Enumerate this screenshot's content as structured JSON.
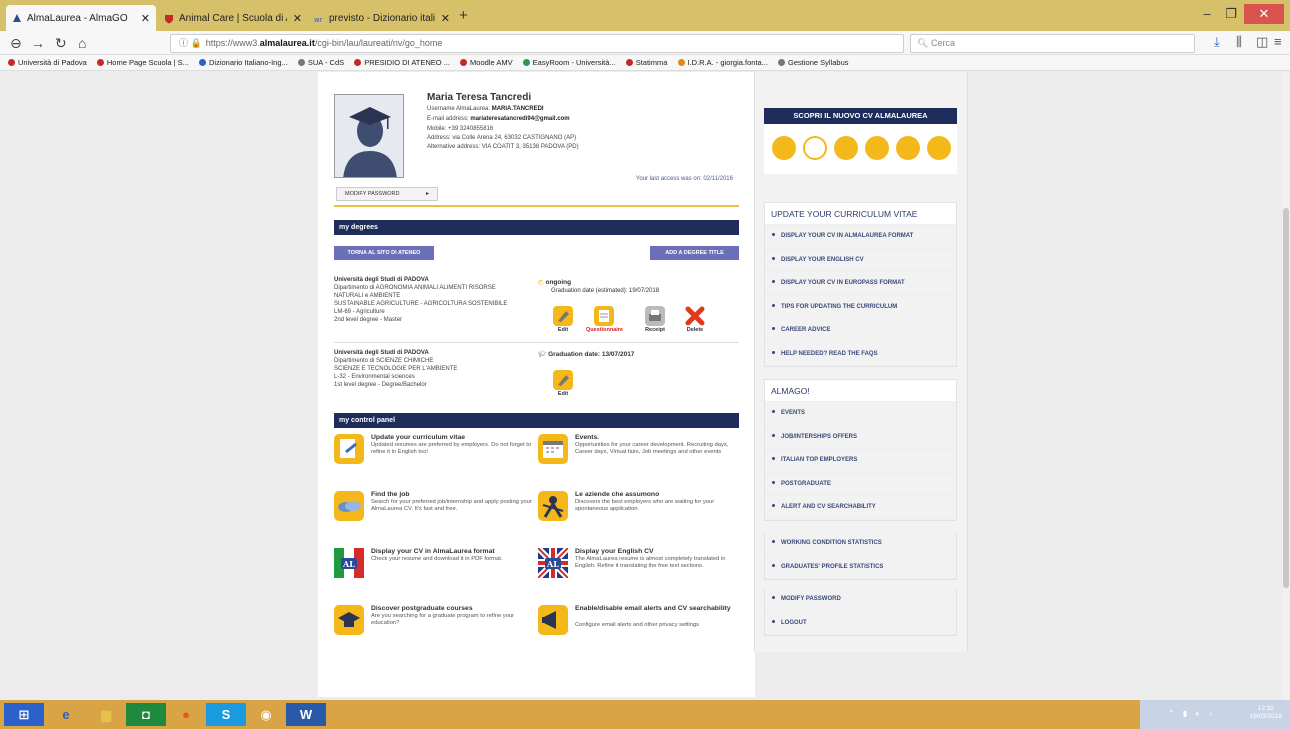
{
  "browser": {
    "tabs": [
      {
        "title": "AlmaLaurea - AlmaGO",
        "icon": "almalaurea-tab-icon",
        "active": true
      },
      {
        "title": "Animal Care | Scuola di Agraria",
        "icon": "unipd-shield-icon",
        "active": false
      },
      {
        "title": "previsto - Dizionario italiano-inglese",
        "icon": "wordreference-icon",
        "active": false
      }
    ],
    "url_prefix": "https://www3.",
    "url_domain": "almalaurea.it",
    "url_path": "/cgi-bin/lau/laureati/nv/go_home",
    "search_placeholder": "Cerca",
    "bookmarks": [
      "Università di Padova",
      "Home Page Scuola | S...",
      "Dizionario Italiano-Ing...",
      "SUA - CdS",
      "PRESIDIO DI ATENEO ...",
      "Moodle AMV",
      "EasyRoom - Università...",
      "Statimma",
      "I.D.R.A. - giorgia.fonta...",
      "Gestione Syllabus"
    ]
  },
  "profile": {
    "name": "Maria Teresa Tancredi",
    "username_label": "Username AlmaLaurea:",
    "username": "MARIA.TANCREDI",
    "email_label": "E-mail address:",
    "email": "mariateresatancredi94@gmail.com",
    "mobile": "Mobile: +39 3240855816",
    "address": "Address: via Colle Arena 24, 63032 CASTIGNANO (AP)",
    "alt_address": "Alternative address: VIA COATIT 3, 35138 PADOVA (PD)",
    "last_access": "Your last access was on: 02/11/2016",
    "modify_password": "MODIFY PASSWORD"
  },
  "degrees": {
    "section_title": "my degrees",
    "back_button": "TORNA AL SITO DI ATENEO",
    "add_button": "ADD A DEGREE TITLE",
    "items": [
      {
        "university": "Università degli Studi di PADOVA",
        "lines": [
          "Dipartimento di AGRONOMIA ANIMALI ALIMENTI RISORSE",
          "NATURALI e AMBIENTE",
          "SUSTAINABLE AGRICULTURE - AGRICOLTURA SOSTENIBILE",
          "LM-69 - Agriculture",
          "2nd level degree - Master"
        ],
        "status": "ongoing",
        "date": "Graduation date (estimated): 19/07/2018",
        "actions": [
          "Edit",
          "Questionnaire",
          "Receipt",
          "Delete"
        ]
      },
      {
        "university": "Università degli Studi di PADOVA",
        "lines": [
          "Dipartimento di SCIENZE CHIMICHE",
          "SCIENZE E TECNOLOGIE PER L'AMBIENTE",
          "L-32 - Environmental sciences",
          "1st level degree - Degree/Bachelor"
        ],
        "date": "Graduation date: 13/07/2017",
        "actions": [
          "Edit"
        ]
      }
    ]
  },
  "control_panel": {
    "section_title": "my control panel",
    "items": [
      {
        "title": "Update your curriculum vitae",
        "desc": "Updated resumes are preferred by employers. Do not forget to refine it in English too!"
      },
      {
        "title": "Events.",
        "desc": "Opportunities for your career development. Recruiting days, Career days, Virtual fairs, Job meetings and other events"
      },
      {
        "title": "Find the job",
        "desc": "Search for your preferred job/internship and apply posting your AlmaLaurea CV. It's fast and free."
      },
      {
        "title": "Le aziende che assumono",
        "desc": "Discovers the best employers who are waiting for your spontaneous application."
      },
      {
        "title": "Display your CV in AlmaLaurea format",
        "desc": "Check your resume and download it in PDF format."
      },
      {
        "title": "Display your English CV",
        "desc": "The AlmaLaurea resume is almost completely translated in English. Refine it translating the free text sections."
      },
      {
        "title": "Discover postgraduate courses",
        "desc": "Are you searching for a graduate program to refine your education?"
      },
      {
        "title": "Enable/disable email alerts and CV searchability",
        "desc": "Configure email alerts and other privacy settings"
      }
    ]
  },
  "sidebar": {
    "promo_title": "SCOPRI IL NUOVO CV ALMALAUREA",
    "cv_title": "UPDATE YOUR CURRICULUM VITAE",
    "cv_items": [
      "DISPLAY YOUR CV IN ALMALAUREA FORMAT",
      "DISPLAY YOUR ENGLISH CV",
      "DISPLAY YOUR CV IN EUROPASS FORMAT",
      "TIPS FOR UPDATING THE CURRICULUM",
      "CAREER ADVICE",
      "HELP NEEDED? READ THE FAQS"
    ],
    "almago_title": "ALMAGO!",
    "almago_items": [
      "EVENTS",
      "JOB/INTERSHIPS OFFERS",
      "ITALIAN TOP EMPLOYERS",
      "POSTGRADUATE",
      "ALERT AND CV SEARCHABILITY"
    ],
    "stats_items": [
      "WORKING CONDITION STATISTICS",
      "GRADUATES' PROFILE STATISTICS"
    ],
    "account_items": [
      "MODIFY PASSWORD",
      "LOGOUT"
    ]
  },
  "taskbar": {
    "time": "12:32",
    "date": "19/03/2018"
  },
  "colors": {
    "navy": "#1e2c5a",
    "purple_button": "#6b6fb8",
    "accent_yellow": "#f5b81a",
    "tab_bar": "#d7c06a",
    "taskbar": "#d8a445"
  }
}
